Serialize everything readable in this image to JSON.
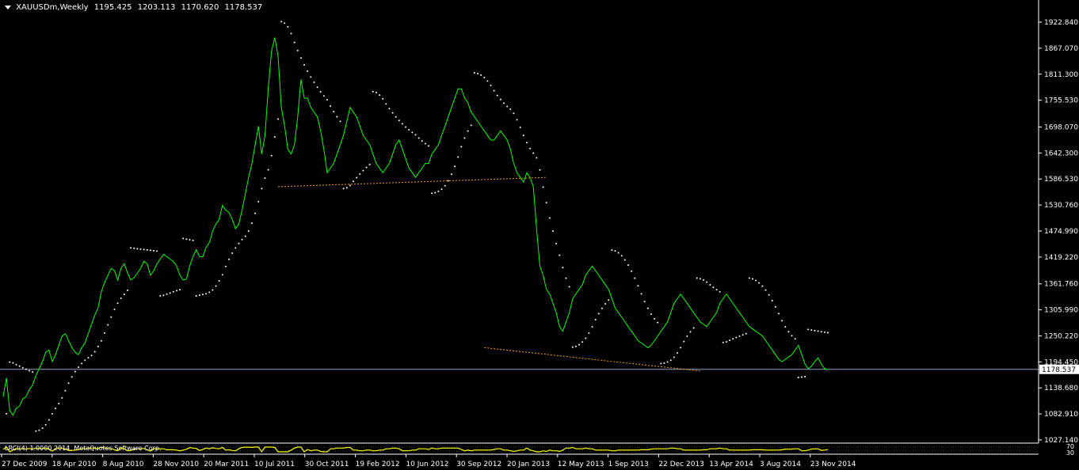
{
  "header": {
    "symbol": "XAUUSDm,Weekly",
    "open": "1195.425",
    "high": "1203.113",
    "low": "1170.620",
    "close": "1178.537"
  },
  "colors": {
    "background": "#000000",
    "price_line": "#00ff00",
    "sar_dots": "#ffffff",
    "trendline": "#ff9900",
    "current_price_line": "#8fa3c0",
    "indicator_line": "#ffff00",
    "axis": "#ffffff"
  },
  "indicator": {
    "label": "LRCI(4) 1.0000 2014, MetaQuotes Software Corp.",
    "levels": [
      "70",
      "30"
    ]
  },
  "chart_data": {
    "type": "line",
    "title": "",
    "series": [
      {
        "values": [
          1120,
          1160,
          1090,
          1080,
          1095,
          1100,
          1115,
          1120,
          1135,
          1145,
          1165,
          1180,
          1195,
          1215,
          1220,
          1195,
          1210,
          1230,
          1250,
          1255,
          1240,
          1225,
          1215,
          1210,
          1225,
          1235,
          1255,
          1275,
          1295,
          1310,
          1345,
          1365,
          1380,
          1395,
          1390,
          1370,
          1395,
          1405,
          1385,
          1370,
          1375,
          1385,
          1395,
          1410,
          1405,
          1380,
          1390,
          1405,
          1415,
          1425,
          1420,
          1415,
          1410,
          1400,
          1380,
          1370,
          1372,
          1400,
          1420,
          1435,
          1420,
          1420,
          1440,
          1450,
          1475,
          1490,
          1500,
          1530,
          1520,
          1515,
          1500,
          1480,
          1490,
          1520,
          1555,
          1590,
          1620,
          1660,
          1700,
          1640,
          1680,
          1780,
          1860,
          1890,
          1850,
          1740,
          1700,
          1650,
          1640,
          1660,
          1720,
          1800,
          1760,
          1760,
          1740,
          1730,
          1720,
          1690,
          1650,
          1600,
          1610,
          1620,
          1640,
          1660,
          1680,
          1710,
          1740,
          1730,
          1720,
          1700,
          1680,
          1670,
          1660,
          1640,
          1620,
          1610,
          1600,
          1610,
          1620,
          1640,
          1660,
          1670,
          1650,
          1630,
          1610,
          1600,
          1590,
          1600,
          1610,
          1620,
          1620,
          1640,
          1650,
          1660,
          1680,
          1700,
          1720,
          1740,
          1760,
          1780,
          1780,
          1760,
          1750,
          1730,
          1720,
          1710,
          1700,
          1690,
          1680,
          1670,
          1670,
          1680,
          1690,
          1680,
          1670,
          1650,
          1620,
          1600,
          1590,
          1580,
          1600,
          1590,
          1570,
          1480,
          1400,
          1380,
          1350,
          1340,
          1320,
          1300,
          1270,
          1260,
          1280,
          1300,
          1330,
          1340,
          1350,
          1360,
          1380,
          1390,
          1400,
          1390,
          1380,
          1370,
          1360,
          1350,
          1330,
          1310,
          1300,
          1290,
          1280,
          1270,
          1260,
          1250,
          1240,
          1235,
          1230,
          1225,
          1230,
          1240,
          1250,
          1260,
          1270,
          1280,
          1300,
          1320,
          1330,
          1340,
          1330,
          1320,
          1310,
          1300,
          1290,
          1280,
          1275,
          1270,
          1280,
          1290,
          1300,
          1320,
          1330,
          1340,
          1330,
          1320,
          1310,
          1300,
          1290,
          1280,
          1270,
          1265,
          1260,
          1255,
          1250,
          1240,
          1230,
          1220,
          1210,
          1200,
          1195,
          1200,
          1205,
          1210,
          1220,
          1230,
          1210,
          1190,
          1180,
          1185,
          1195,
          1203,
          1190,
          1180,
          1178
        ]
      }
    ],
    "x_tick_labels": [
      "27 Dec 2009",
      "18 Apr 2010",
      "8 Aug 2010",
      "28 Nov 2010",
      "20 Mar 2011",
      "10 Jul 2011",
      "30 Oct 2011",
      "19 Feb 2012",
      "10 Jun 2012",
      "30 Sep 2012",
      "20 Jan 2013",
      "12 May 2013",
      "1 Sep 2013",
      "22 Dec 2013",
      "13 Apr 2014",
      "3 Aug 2014",
      "23 Nov 2014"
    ],
    "y_tick_labels": [
      "1922.840",
      "1867.070",
      "1811.300",
      "1755.530",
      "1698.070",
      "1642.300",
      "1586.530",
      "1530.760",
      "1474.990",
      "1419.220",
      "1361.760",
      "1305.990",
      "1250.220",
      "1194.450",
      "1138.680",
      "1082.910",
      "1027.140"
    ],
    "ylim": [
      1027.14,
      1922.84
    ],
    "current_price": "1178.537",
    "trendlines": [
      {
        "from_index": 84,
        "from_value": 1570,
        "to_index": 166,
        "to_value": 1590
      },
      {
        "from_index": 147,
        "from_value": 1225,
        "to_index": 213,
        "to_value": 1175
      }
    ],
    "grid": false
  }
}
